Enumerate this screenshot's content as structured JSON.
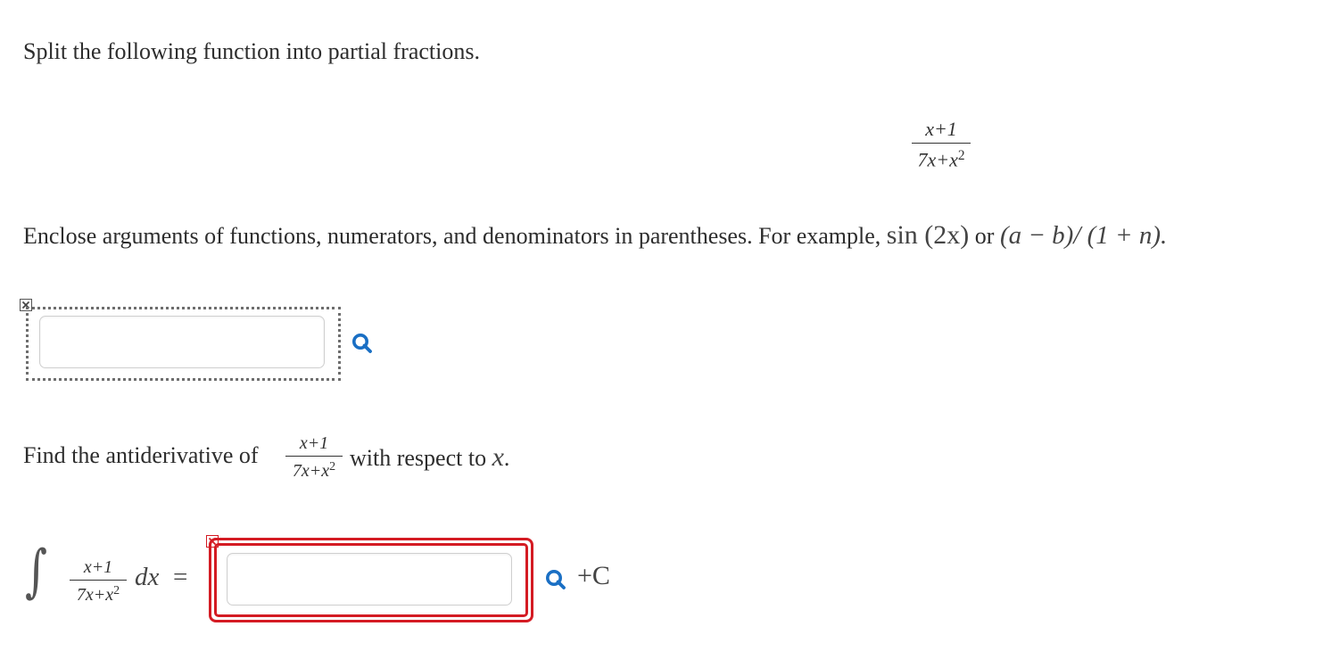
{
  "question1": {
    "prompt": "Split the following function into partial fractions.",
    "function": {
      "numerator": "x+1",
      "denominator_base": "7x+x",
      "denominator_exp": "2"
    },
    "instructions_lead": "Enclose arguments of functions, numerators, and denominators in parentheses. For example, ",
    "example1": "sin (2x)",
    "example_joiner": " or ",
    "example2": "(a − b)/ (1 + n).",
    "answer": {
      "value": "",
      "placeholder": ""
    }
  },
  "question2": {
    "prompt_lead": "Find the antiderivative of ",
    "function": {
      "numerator": "x+1",
      "denominator_base": "7x+x",
      "denominator_exp": "2"
    },
    "prompt_tail": " with respect to ",
    "variable": "x",
    "period": ".",
    "integral_sign": "∫",
    "dx": "dx",
    "equals": "=",
    "constant": "+C",
    "answer": {
      "value": "",
      "placeholder": ""
    }
  },
  "colors": {
    "error_red": "#d41b23",
    "search_blue": "#1a6fc4",
    "dotted_gray": "#6e6e6e"
  },
  "icons": {
    "search": "search-icon",
    "mark": "x-mark-icon"
  }
}
